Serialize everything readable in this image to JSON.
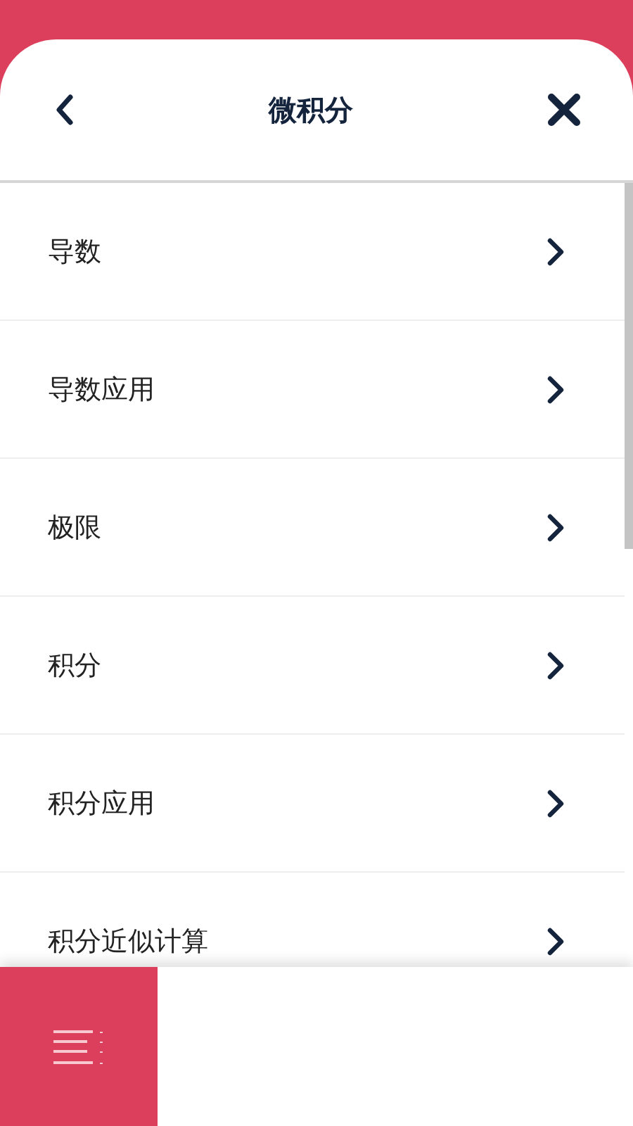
{
  "header": {
    "title": "微积分"
  },
  "items": [
    {
      "label": "导数"
    },
    {
      "label": "导数应用"
    },
    {
      "label": "极限"
    },
    {
      "label": "积分"
    },
    {
      "label": "积分应用"
    },
    {
      "label": "积分近似计算"
    }
  ]
}
